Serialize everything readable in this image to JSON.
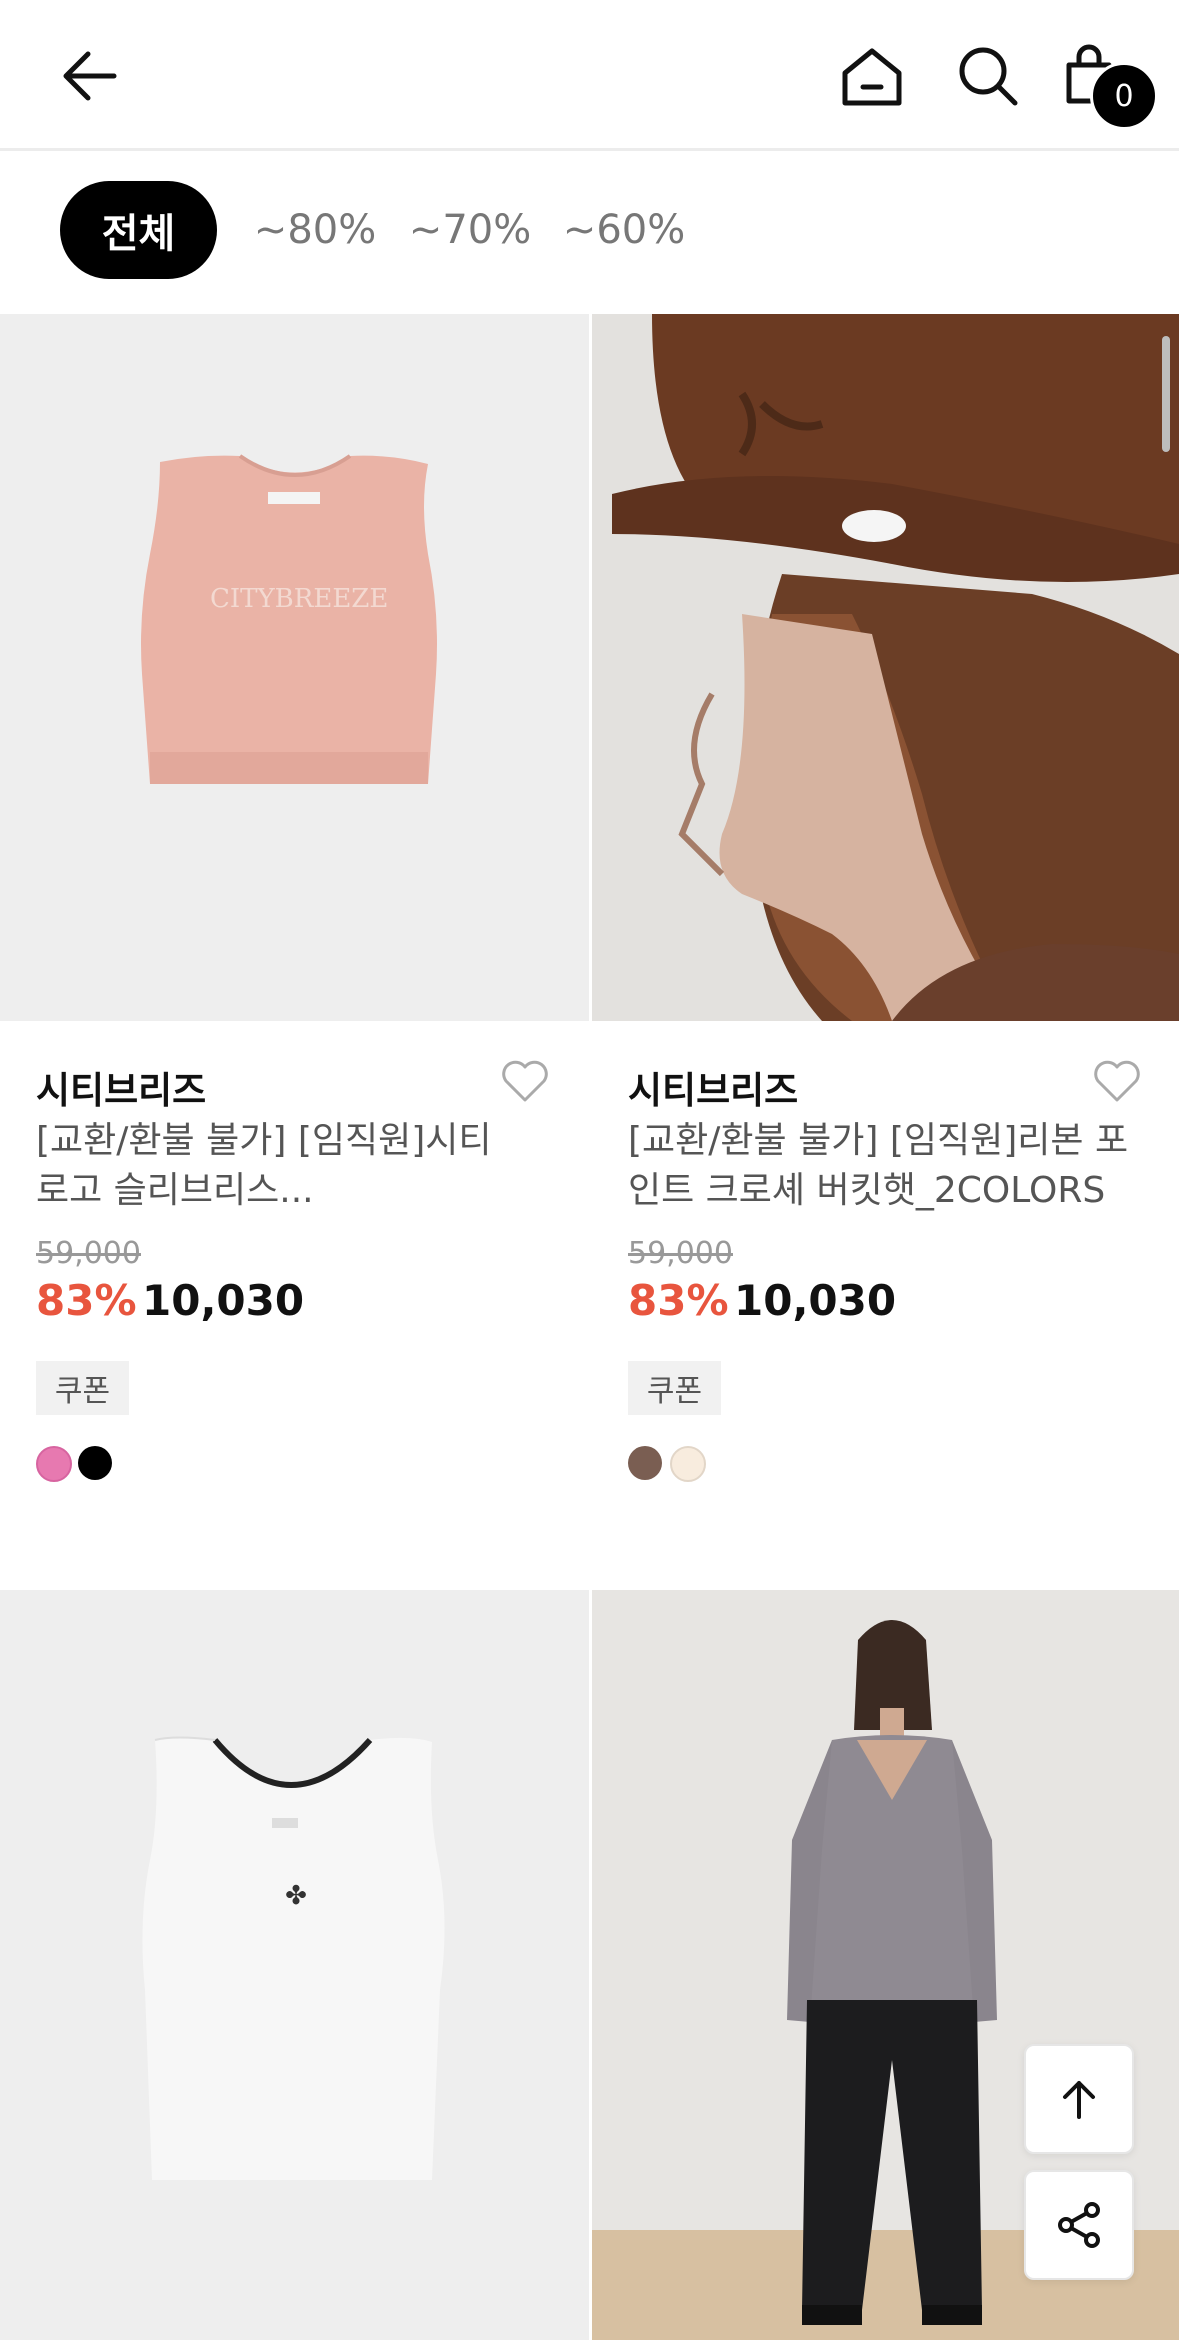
{
  "header": {
    "cart_count": "0"
  },
  "filters": [
    {
      "label": "전체",
      "active": true
    },
    {
      "label": "~80%"
    },
    {
      "label": "~70%"
    },
    {
      "label": "~60%"
    }
  ],
  "products": [
    {
      "brand": "시티브리즈",
      "name": "[교환/환불 불가] [임직원]시티 로고 슬리브리스...",
      "original_price": "59,000",
      "discount": "83%",
      "price": "10,030",
      "coupon": "쿠폰",
      "image_logo": "CITYBREEZE",
      "colors": [
        "#e779b0",
        "#000000"
      ]
    },
    {
      "brand": "시티브리즈",
      "name": "[교환/환불 불가] [임직원]리본 포인트 크로셰 버킷햇_2COLORS",
      "original_price": "59,000",
      "discount": "83%",
      "price": "10,030",
      "coupon": "쿠폰",
      "colors": [
        "#7a5e52",
        "#f8ecde"
      ]
    }
  ],
  "colors": {
    "accent": "#e8553e",
    "chip_active_bg": "#000000"
  }
}
